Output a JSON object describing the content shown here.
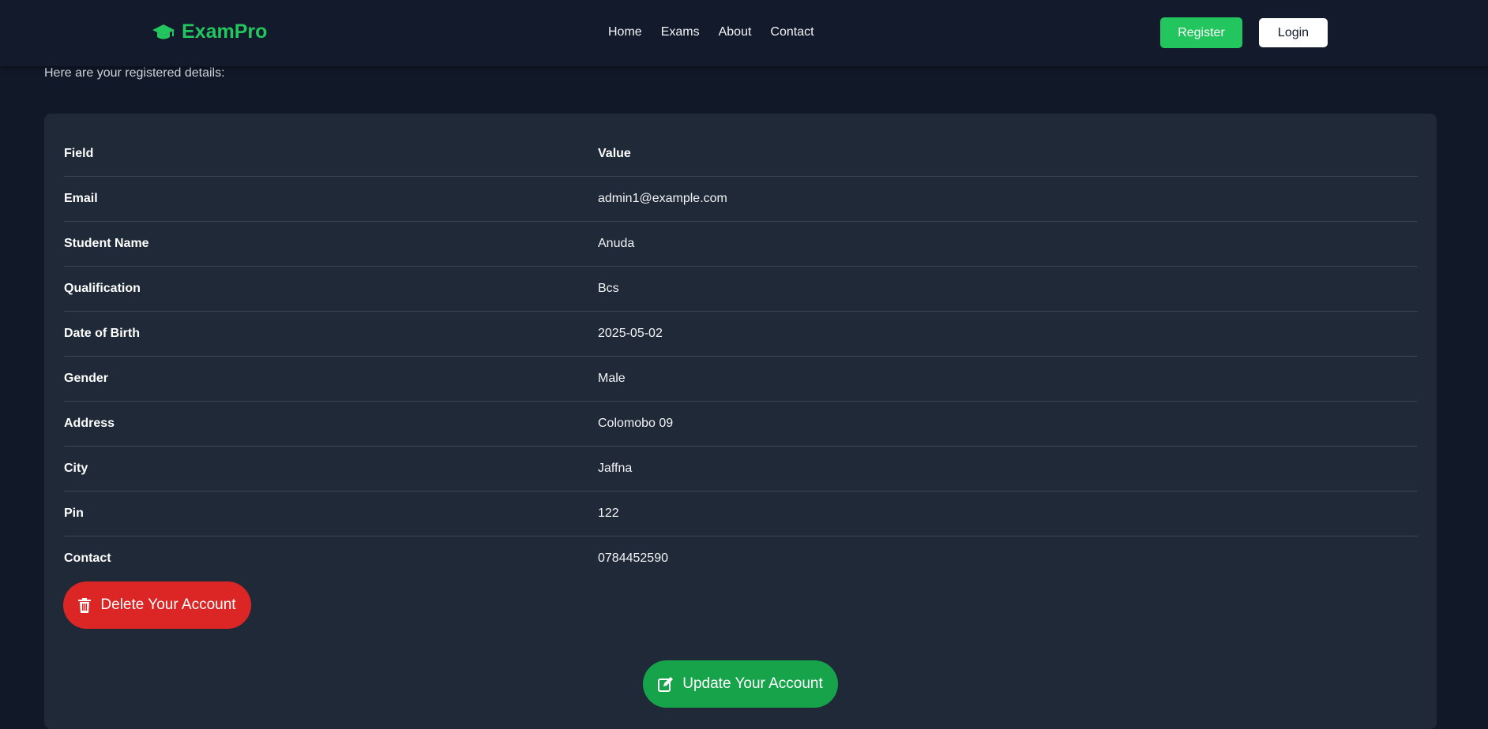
{
  "navbar": {
    "brand": "ExamPro",
    "brand_icon": "graduation-cap-icon",
    "links": [
      "Home",
      "Exams",
      "About",
      "Contact"
    ],
    "register_label": "Register",
    "login_label": "Login"
  },
  "intro_text": "Here are your registered details:",
  "details": {
    "header_field": "Field",
    "header_value": "Value",
    "rows": [
      {
        "field": "Email",
        "value": "admin1@example.com"
      },
      {
        "field": "Student Name",
        "value": "Anuda"
      },
      {
        "field": "Qualification",
        "value": "Bcs"
      },
      {
        "field": "Date of Birth",
        "value": "2025-05-02"
      },
      {
        "field": "Gender",
        "value": "Male"
      },
      {
        "field": "Address",
        "value": "Colomobo 09"
      },
      {
        "field": "City",
        "value": "Jaffna"
      },
      {
        "field": "Pin",
        "value": "122"
      },
      {
        "field": "Contact",
        "value": "0784452590"
      }
    ]
  },
  "actions": {
    "delete_label": "Delete Your Account",
    "delete_icon": "trash-icon",
    "update_label": "Update Your Account",
    "update_icon": "edit-icon"
  },
  "colors": {
    "accent_green": "#22c55e",
    "danger_red": "#dc2626",
    "background": "#111827",
    "card": "#1f2937"
  }
}
